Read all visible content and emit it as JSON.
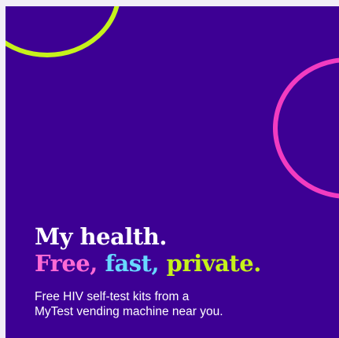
{
  "headline": {
    "line1": "My health.",
    "word_free": "Free,",
    "word_fast": "fast,",
    "word_private": "private."
  },
  "subcopy": {
    "line1": "Free HIV self-test kits from a",
    "line2": "MyTest vending machine near you."
  },
  "colors": {
    "background": "#3d0094",
    "page": "#f1eef7",
    "lime": "#c6f21b",
    "pink": "#f23cc1",
    "cyan": "#67d9ff",
    "text": "#ffffff"
  }
}
